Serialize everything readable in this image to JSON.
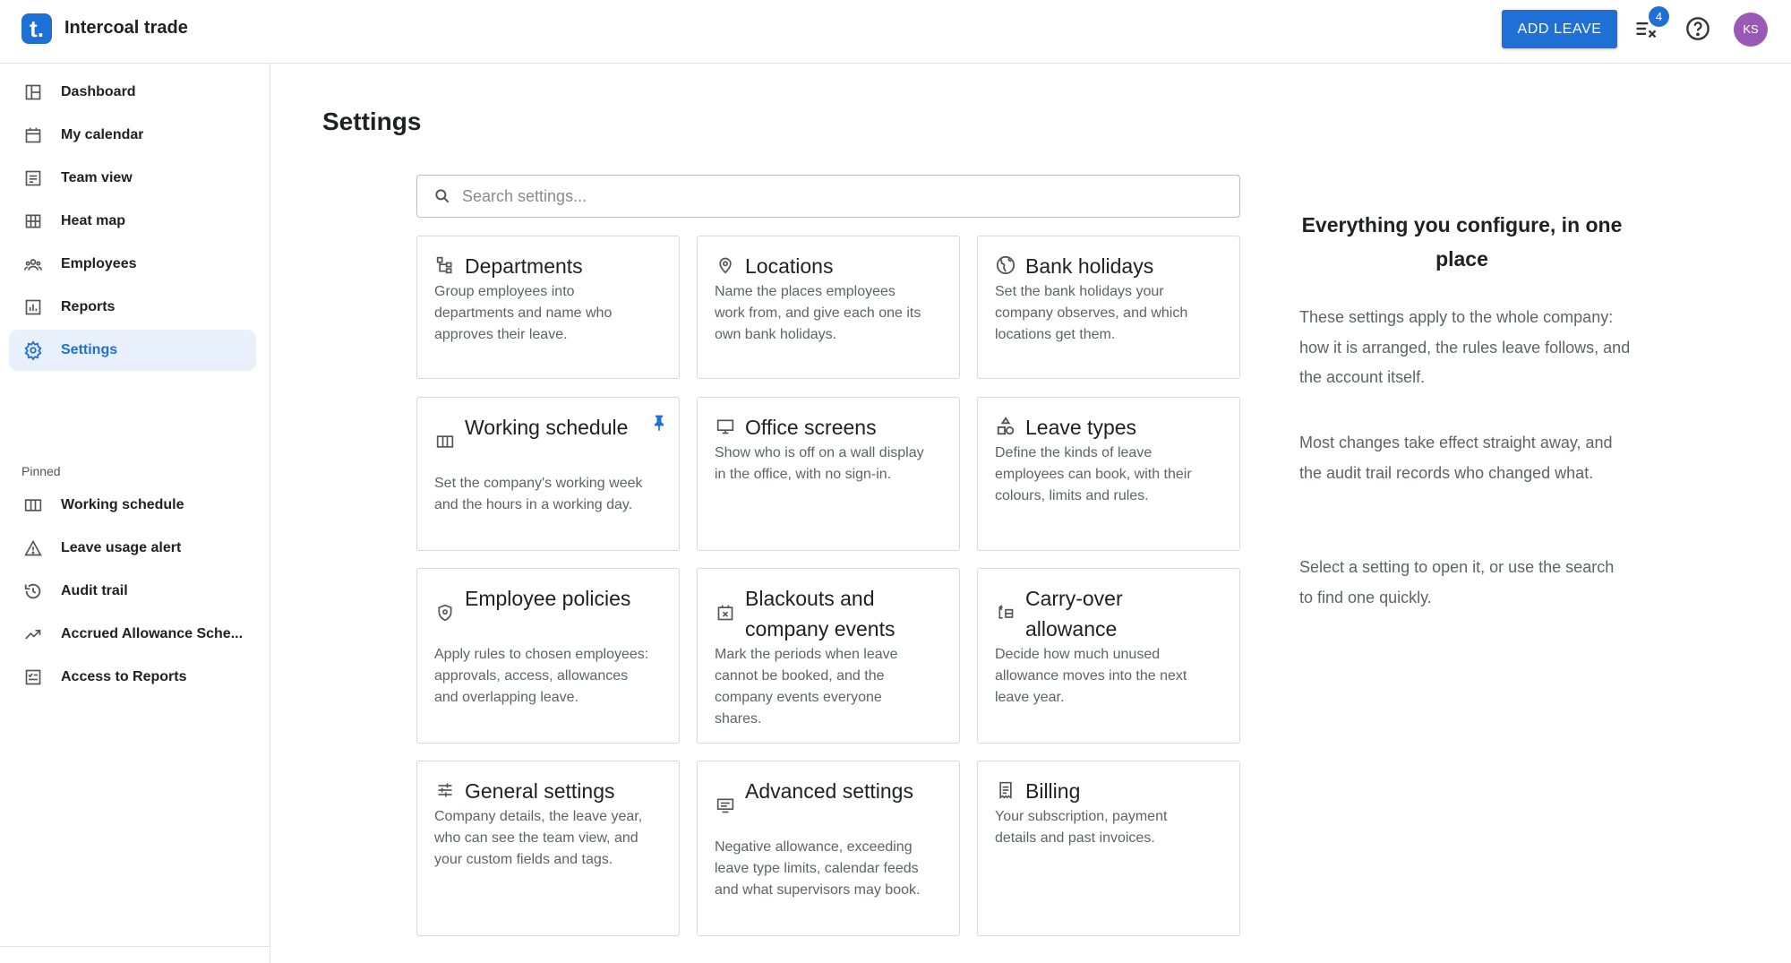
{
  "app": {
    "logo_letter": "t.",
    "name": "Intercoal trade"
  },
  "topbar": {
    "add_leave_label": "ADD LEAVE",
    "notification_count": "4",
    "avatar_initials": "KS"
  },
  "sidebar": {
    "items": [
      {
        "label": "Dashboard",
        "icon": "dashboard-icon"
      },
      {
        "label": "My calendar",
        "icon": "calendar-icon"
      },
      {
        "label": "Team view",
        "icon": "team-view-icon"
      },
      {
        "label": "Heat map",
        "icon": "grid-icon"
      },
      {
        "label": "Employees",
        "icon": "people-icon"
      },
      {
        "label": "Reports",
        "icon": "bar-chart-icon"
      },
      {
        "label": "Settings",
        "icon": "gear-icon",
        "active": true
      }
    ],
    "pinned_title": "Pinned",
    "pinned": [
      {
        "label": "Working schedule",
        "icon": "columns-icon"
      },
      {
        "label": "Leave usage alert",
        "icon": "warning-icon"
      },
      {
        "label": "Audit trail",
        "icon": "history-icon"
      },
      {
        "label": "Accrued Allowance Sche...",
        "icon": "trending-up-icon"
      },
      {
        "label": "Access to Reports",
        "icon": "checklist-icon"
      }
    ]
  },
  "main": {
    "title": "Settings",
    "search_placeholder": "Search settings...",
    "cards": [
      {
        "title": "Departments",
        "desc": "Group employees into departments and name who approves their leave.",
        "icon": "departments-icon"
      },
      {
        "title": "Locations",
        "desc": "Name the places employees work from, and give each one its own bank holidays.",
        "icon": "location-pin-icon"
      },
      {
        "title": "Bank holidays",
        "desc": "Set the bank holidays your company observes, and which locations get them.",
        "icon": "globe-icon"
      },
      {
        "title": "Working schedule",
        "desc": "Set the company's working week and the hours in a working day.",
        "icon": "columns-icon",
        "pinned": true
      },
      {
        "title": "Office screens",
        "desc": "Show who is off on a wall display in the office, with no sign-in.",
        "icon": "monitor-icon"
      },
      {
        "title": "Leave types",
        "desc": "Define the kinds of leave employees can book, with their colours, limits and rules.",
        "icon": "shapes-icon"
      },
      {
        "title": "Employee policies",
        "desc": "Apply rules to chosen employees: approvals, access, allowances and overlapping leave.",
        "icon": "shield-icon"
      },
      {
        "title": "Blackouts and company events",
        "desc": "Mark the periods when leave cannot be booked, and the company events everyone shares.",
        "icon": "calendar-x-icon"
      },
      {
        "title": "Carry-over allowance",
        "desc": "Decide how much unused allowance moves into the next leave year.",
        "icon": "carry-over-icon"
      },
      {
        "title": "General settings",
        "desc": "Company details, the leave year, who can see the team view, and your custom fields and tags.",
        "icon": "sliders-icon"
      },
      {
        "title": "Advanced settings",
        "desc": "Negative allowance, exceeding leave type limits, calendar feeds and what supervisors may book.",
        "icon": "advanced-icon"
      },
      {
        "title": "Billing",
        "desc": "Your subscription, payment details and past invoices.",
        "icon": "receipt-icon"
      }
    ]
  },
  "right_panel": {
    "title": "Everything you configure, in one place",
    "paragraphs": [
      "These settings apply to the whole company: how it is arranged, the rules leave follows, and the account itself.",
      "Most changes take effect straight away, and the audit trail records who changed what.",
      "Select a setting to open it, or use the search to find one quickly."
    ]
  },
  "colors": {
    "accent": "#1e6fd6",
    "active_bg": "#e8f0fb",
    "avatar": "#9b59b6"
  }
}
